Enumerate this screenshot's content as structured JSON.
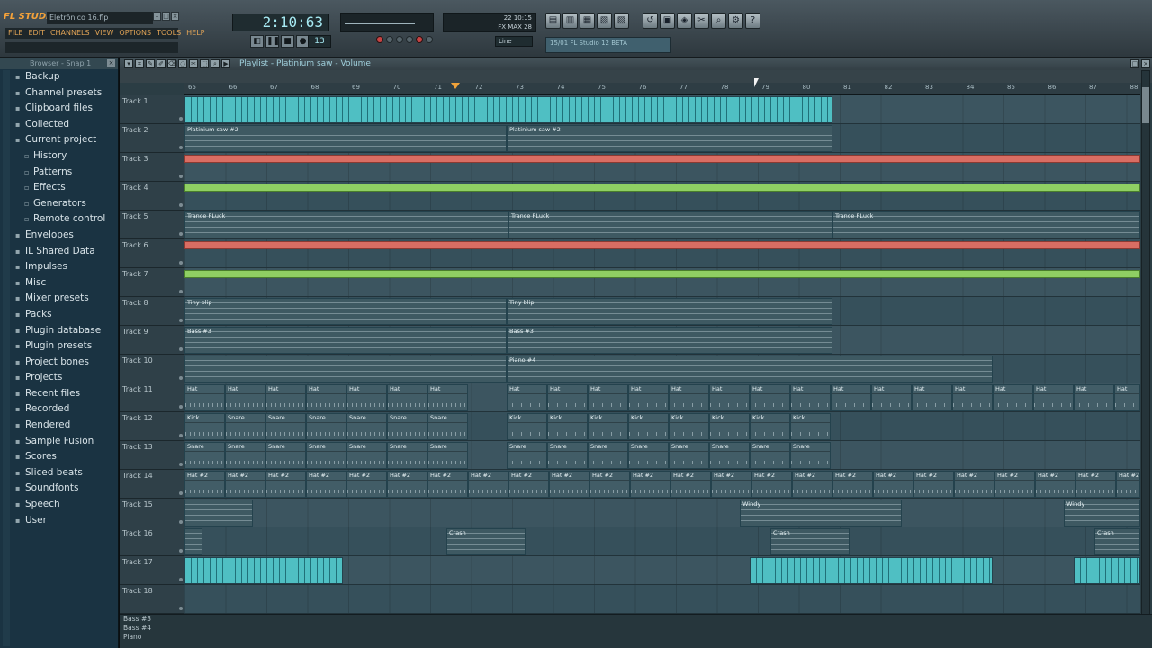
{
  "app": {
    "logo": "FL STUDIO",
    "filename": "Eletrônico 16.flp"
  },
  "menu": [
    "FILE",
    "EDIT",
    "CHANNELS",
    "VIEW",
    "OPTIONS",
    "TOOLS",
    "HELP"
  ],
  "transport": {
    "time": "2:10:63",
    "pattern": "13",
    "snap": "Line"
  },
  "cpu": {
    "line1": "22  10:15",
    "line2": "FX  MAX  28"
  },
  "song_hint": "15/01 FL Studio 12 BETA",
  "browser": {
    "title": "Browser - Snap 1",
    "items": [
      {
        "label": "Backup",
        "sub": false
      },
      {
        "label": "Channel presets",
        "sub": false
      },
      {
        "label": "Clipboard files",
        "sub": false
      },
      {
        "label": "Collected",
        "sub": false
      },
      {
        "label": "Current project",
        "sub": false
      },
      {
        "label": "History",
        "sub": true
      },
      {
        "label": "Patterns",
        "sub": true
      },
      {
        "label": "Effects",
        "sub": true
      },
      {
        "label": "Generators",
        "sub": true
      },
      {
        "label": "Remote control",
        "sub": true
      },
      {
        "label": "Envelopes",
        "sub": false
      },
      {
        "label": "IL Shared Data",
        "sub": false
      },
      {
        "label": "Impulses",
        "sub": false
      },
      {
        "label": "Misc",
        "sub": false
      },
      {
        "label": "Mixer presets",
        "sub": false
      },
      {
        "label": "Packs",
        "sub": false
      },
      {
        "label": "Plugin database",
        "sub": false
      },
      {
        "label": "Plugin presets",
        "sub": false
      },
      {
        "label": "Project bones",
        "sub": false
      },
      {
        "label": "Projects",
        "sub": false
      },
      {
        "label": "Recent files",
        "sub": false
      },
      {
        "label": "Recorded",
        "sub": false
      },
      {
        "label": "Rendered",
        "sub": false
      },
      {
        "label": "Sample Fusion",
        "sub": false
      },
      {
        "label": "Scores",
        "sub": false
      },
      {
        "label": "Sliced beats",
        "sub": false
      },
      {
        "label": "Soundfonts",
        "sub": false
      },
      {
        "label": "Speech",
        "sub": false
      },
      {
        "label": "User",
        "sub": false
      }
    ]
  },
  "playlist": {
    "title": "Playlist - Platinium saw - Volume",
    "ruler": [
      "65",
      "66",
      "67",
      "68",
      "69",
      "70",
      "71",
      "72",
      "73",
      "74",
      "75",
      "76",
      "77",
      "78",
      "79",
      "80",
      "81",
      "82",
      "83",
      "84",
      "85",
      "86",
      "87",
      "88"
    ],
    "tracks": [
      "Track 1",
      "Track 2",
      "Track 3",
      "Track 4",
      "Track 5",
      "Track 6",
      "Track 7",
      "Track 8",
      "Track 9",
      "Track 10",
      "Track 11",
      "Track 12",
      "Track 13",
      "Track 14",
      "Track 15",
      "Track 16",
      "Track 17",
      "Track 18"
    ],
    "bottom_labels": [
      "Bass #3",
      "Bass #4",
      "Piano"
    ],
    "clips": [
      {
        "row": 0,
        "kind": "audio",
        "name": "",
        "start": 0,
        "len": 720
      },
      {
        "row": 1,
        "kind": "notes",
        "name": "Platinium saw #2",
        "start": 0,
        "len": 358
      },
      {
        "row": 1,
        "kind": "notes",
        "name": "Platinium saw #2",
        "start": 358,
        "len": 362
      },
      {
        "row": 2,
        "kind": "red",
        "name": "",
        "start": 0,
        "len": 1062
      },
      {
        "row": 3,
        "kind": "green",
        "name": "",
        "start": 0,
        "len": 1062
      },
      {
        "row": 4,
        "kind": "notes",
        "name": "Trance PLuck",
        "start": 0,
        "len": 360
      },
      {
        "row": 4,
        "kind": "notes",
        "name": "Trance PLuck",
        "start": 360,
        "len": 360
      },
      {
        "row": 4,
        "kind": "notes",
        "name": "Trance PLuck",
        "start": 720,
        "len": 342
      },
      {
        "row": 5,
        "kind": "red",
        "name": "",
        "start": 0,
        "len": 1062
      },
      {
        "row": 6,
        "kind": "green",
        "name": "",
        "start": 0,
        "len": 1062
      },
      {
        "row": 7,
        "kind": "notes",
        "name": "Tiny blip",
        "start": 0,
        "len": 358
      },
      {
        "row": 7,
        "kind": "notes",
        "name": "Tiny blip",
        "start": 358,
        "len": 362
      },
      {
        "row": 8,
        "kind": "notes",
        "name": "Bass #3",
        "start": 0,
        "len": 358
      },
      {
        "row": 8,
        "kind": "notes",
        "name": "Bass #3",
        "start": 358,
        "len": 362
      },
      {
        "row": 9,
        "kind": "notes",
        "name": "",
        "start": 0,
        "len": 358
      },
      {
        "row": 9,
        "kind": "notes",
        "name": "Piano #4",
        "start": 358,
        "len": 540
      },
      {
        "row": 10,
        "kind": "hat",
        "name": "Hat",
        "start": 0,
        "len": 45,
        "repeat": 7,
        "step": 45
      },
      {
        "row": 10,
        "kind": "hat",
        "name": "Hat",
        "start": 358,
        "len": 45,
        "repeat": 16,
        "step": 45
      },
      {
        "row": 11,
        "kind": "hat",
        "name": "Kick",
        "start": 0,
        "len": 45,
        "repeat": 1,
        "step": 45
      },
      {
        "row": 11,
        "kind": "hat",
        "name": "Snare",
        "start": 45,
        "len": 45,
        "repeat": 6,
        "step": 45
      },
      {
        "row": 11,
        "kind": "hat",
        "name": "Kick",
        "start": 358,
        "len": 45,
        "repeat": 8,
        "step": 45
      },
      {
        "row": 12,
        "kind": "hat",
        "name": "Snare",
        "start": 0,
        "len": 45,
        "repeat": 7,
        "step": 45
      },
      {
        "row": 12,
        "kind": "hat",
        "name": "Snare",
        "start": 358,
        "len": 45,
        "repeat": 8,
        "step": 45
      },
      {
        "row": 13,
        "kind": "hat",
        "name": "Hat #2",
        "start": 0,
        "len": 45,
        "repeat": 24,
        "step": 45
      },
      {
        "row": 14,
        "kind": "notes",
        "name": "",
        "start": 0,
        "len": 76
      },
      {
        "row": 14,
        "kind": "notes",
        "name": "Windy",
        "start": 617,
        "len": 180
      },
      {
        "row": 14,
        "kind": "notes",
        "name": "Windy",
        "start": 977,
        "len": 85
      },
      {
        "row": 15,
        "kind": "notes",
        "name": "",
        "start": 0,
        "len": 20
      },
      {
        "row": 15,
        "kind": "notes",
        "name": "Crash",
        "start": 291,
        "len": 88
      },
      {
        "row": 15,
        "kind": "notes",
        "name": "Crash",
        "start": 651,
        "len": 88
      },
      {
        "row": 15,
        "kind": "notes",
        "name": "Crash",
        "start": 1011,
        "len": 51
      },
      {
        "row": 16,
        "kind": "audio",
        "name": "",
        "start": 0,
        "len": 176
      },
      {
        "row": 16,
        "kind": "audio",
        "name": "",
        "start": 628,
        "len": 270
      },
      {
        "row": 16,
        "kind": "audio",
        "name": "",
        "start": 988,
        "len": 74
      }
    ]
  }
}
